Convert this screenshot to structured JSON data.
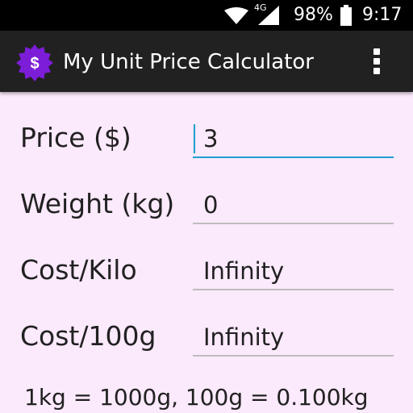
{
  "status_bar": {
    "network_type": "4G",
    "battery_percent": "98%",
    "time": "9:17"
  },
  "app_bar": {
    "icon_symbol": "$",
    "title": "My Unit Price Calculator",
    "icon_color": "#7c1dd8"
  },
  "form": {
    "price": {
      "label": "Price ($)",
      "value": "3"
    },
    "weight": {
      "label": "Weight (kg)",
      "value": "0"
    },
    "cost_per_kilo": {
      "label": "Cost/Kilo",
      "value": "Infinity"
    },
    "cost_per_100g": {
      "label": "Cost/100g",
      "value": "Infinity"
    }
  },
  "footer": {
    "conversion_note": "1kg = 1000g, 100g = 0.100kg"
  },
  "colors": {
    "background": "#fbe9fc",
    "app_bar": "#212121",
    "focus_accent": "#1e9fcf"
  }
}
